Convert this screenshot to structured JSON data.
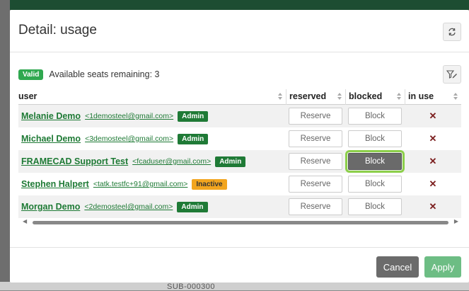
{
  "background": {
    "footer_text": "SUB-000300"
  },
  "dialog": {
    "title": "Detail: usage",
    "refresh_icon": "refresh-icon",
    "filter_icon": "filter-edit-icon"
  },
  "status": {
    "badge": "Valid",
    "text": "Available seats remaining: 3"
  },
  "table": {
    "columns": {
      "user": "user",
      "reserved": "reserved",
      "blocked": "blocked",
      "in_use": "in use"
    },
    "rows": [
      {
        "name": "Melanie Demo",
        "email": "<1demosteel@gmail.com>",
        "role": "Admin",
        "reserve": "Reserve",
        "block": "Block",
        "in_use": "✕"
      },
      {
        "name": "Michael Demo",
        "email": "<3demosteel@gmail.com>",
        "role": "Admin",
        "reserve": "Reserve",
        "block": "Block",
        "in_use": "✕"
      },
      {
        "name": "FRAMECAD Support Test",
        "email": "<fcaduser@gmail.com>",
        "role": "Admin",
        "reserve": "Reserve",
        "block": "Block",
        "in_use": "✕"
      },
      {
        "name": "Stephen Halpert",
        "email": "<tatk.testfc+91@gmail.com>",
        "role": "Inactive",
        "reserve": "Reserve",
        "block": "Block",
        "in_use": "✕"
      },
      {
        "name": "Morgan Demo",
        "email": "<2demosteel@gmail.com>",
        "role": "Admin",
        "reserve": "Reserve",
        "block": "Block",
        "in_use": "✕"
      }
    ]
  },
  "actions": {
    "cancel": "Cancel",
    "apply": "Apply"
  },
  "colors": {
    "accent_green": "#1f7a36",
    "valid_badge": "#2fa84f",
    "inactive_badge": "#f2a51f",
    "highlight": "#8ccf4a"
  }
}
